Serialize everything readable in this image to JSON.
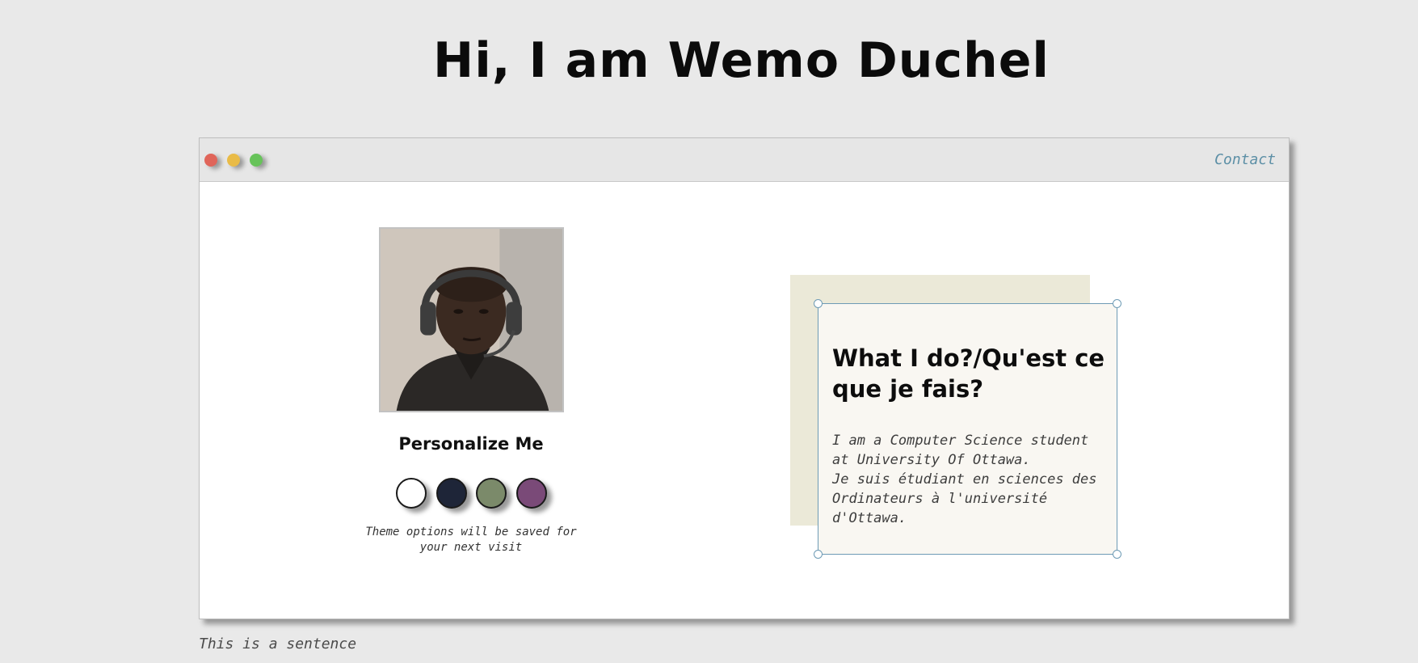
{
  "page": {
    "title": "Hi, I am Wemo Duchel",
    "footer_text": "This is a sentence"
  },
  "window": {
    "controls": [
      "close",
      "minimize",
      "maximize"
    ],
    "nav": {
      "contact_label": "Contact"
    }
  },
  "profile": {
    "photo_alt": "Profile photo of person wearing a headset",
    "personalize_title": "Personalize Me",
    "theme_note": "Theme options will be saved for your next visit",
    "themes": [
      {
        "name": "white",
        "color": "#ffffff"
      },
      {
        "name": "navy",
        "color": "#1e2538"
      },
      {
        "name": "sage",
        "color": "#7b8a6a"
      },
      {
        "name": "purple",
        "color": "#7a4a78"
      }
    ]
  },
  "about": {
    "title": "What I do?/Qu'est ce que je fais?",
    "body": "I am a Computer Science student at University Of Ottawa.\nJe suis étudiant en sciences des Ordinateurs à l'université d'Ottawa."
  },
  "colors": {
    "background": "#e9e9e9",
    "accent": "#5c8fa6",
    "beige": "#ebe9d8"
  }
}
